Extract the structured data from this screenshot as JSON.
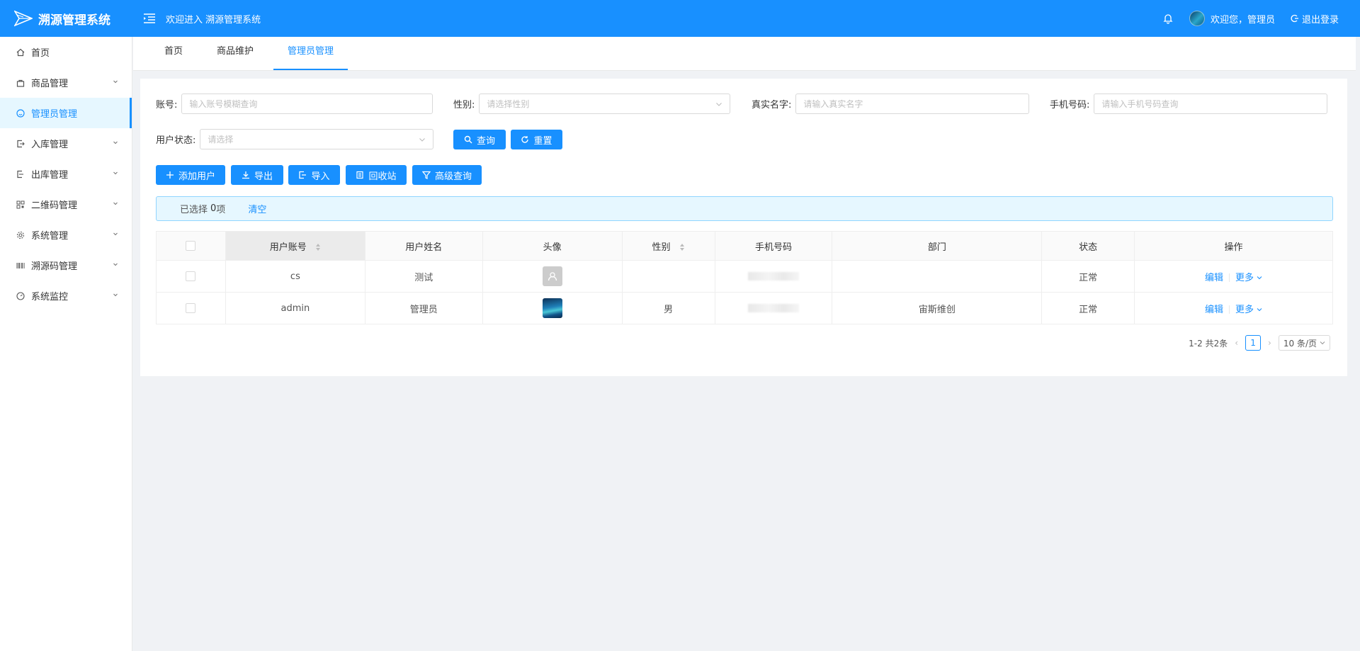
{
  "header": {
    "logo_text": "溯源管理系统",
    "welcome_text": "欢迎进入 溯源管理系统",
    "user_greeting": "欢迎您，管理员",
    "logout_label": "退出登录"
  },
  "sidebar": {
    "items": [
      {
        "label": "首页",
        "icon": "home-icon"
      },
      {
        "label": "商品管理",
        "icon": "bag-icon"
      },
      {
        "label": "管理员管理",
        "icon": "admin-icon"
      },
      {
        "label": "入库管理",
        "icon": "inbound-icon"
      },
      {
        "label": "出库管理",
        "icon": "outbound-icon"
      },
      {
        "label": "二维码管理",
        "icon": "qrcode-icon"
      },
      {
        "label": "系统管理",
        "icon": "gear-icon"
      },
      {
        "label": "溯源码管理",
        "icon": "barcode-icon"
      },
      {
        "label": "系统监控",
        "icon": "dashboard-icon"
      }
    ]
  },
  "tabs": [
    {
      "label": "首页"
    },
    {
      "label": "商品维护"
    },
    {
      "label": "管理员管理"
    }
  ],
  "filters": {
    "account_label": "账号:",
    "account_placeholder": "输入账号模糊查询",
    "gender_label": "性别:",
    "gender_placeholder": "请选择性别",
    "realname_label": "真实名字:",
    "realname_placeholder": "请输入真实名字",
    "phone_label": "手机号码:",
    "phone_placeholder": "请输入手机号码查询",
    "status_label": "用户状态:",
    "status_placeholder": "请选择",
    "search_label": "查询",
    "reset_label": "重置"
  },
  "toolbar": {
    "add_label": "添加用户",
    "export_label": "导出",
    "import_label": "导入",
    "recycle_label": "回收站",
    "advanced_label": "高级查询"
  },
  "selection": {
    "prefix": "已选择",
    "count": "0",
    "suffix": "项",
    "clear_label": "清空"
  },
  "table": {
    "headers": [
      "用户账号",
      "用户姓名",
      "头像",
      "性别",
      "手机号码",
      "部门",
      "状态",
      "操作"
    ],
    "rows": [
      {
        "account": "cs",
        "name": "测试",
        "gender": "",
        "dept": "",
        "status": "正常"
      },
      {
        "account": "admin",
        "name": "管理员",
        "gender": "男",
        "dept": "宙斯维创",
        "status": "正常"
      }
    ],
    "edit_label": "编辑",
    "more_label": "更多"
  },
  "pagination": {
    "summary": "1-2 共2条",
    "current_page": "1",
    "page_size": "10 条/页"
  },
  "colors": {
    "primary": "#1890ff",
    "background": "#f0f2f5"
  }
}
